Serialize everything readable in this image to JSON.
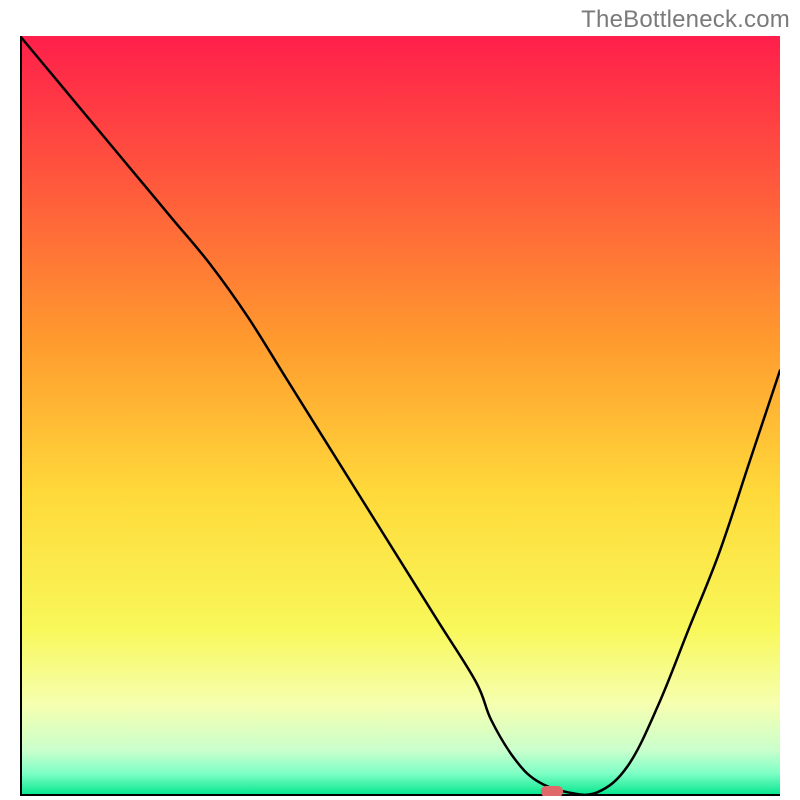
{
  "watermark": "TheBottleneck.com",
  "chart_data": {
    "type": "line",
    "title": "",
    "xlabel": "",
    "ylabel": "",
    "xlim": [
      0,
      100
    ],
    "ylim": [
      0,
      100
    ],
    "grid": false,
    "legend": false,
    "series": [
      {
        "name": "curve",
        "x": [
          0,
          5,
          10,
          15,
          20,
          25,
          30,
          35,
          40,
          45,
          50,
          55,
          60,
          62,
          65,
          68,
          72,
          76,
          80,
          84,
          88,
          92,
          96,
          100
        ],
        "values": [
          100,
          94,
          88,
          82,
          76,
          70,
          63,
          55,
          47,
          39,
          31,
          23,
          15,
          10,
          5,
          2,
          0.5,
          0.5,
          4,
          12,
          22,
          32,
          44,
          56
        ]
      }
    ],
    "marker": {
      "x": 70,
      "y": 0.6,
      "color": "#e06a6a"
    },
    "gradient_background": {
      "stops": [
        {
          "offset": 0.0,
          "color": "#ff1f4b"
        },
        {
          "offset": 0.2,
          "color": "#ff5a3c"
        },
        {
          "offset": 0.4,
          "color": "#ff9a2e"
        },
        {
          "offset": 0.6,
          "color": "#ffd93a"
        },
        {
          "offset": 0.78,
          "color": "#f8f85a"
        },
        {
          "offset": 0.88,
          "color": "#f6ffb0"
        },
        {
          "offset": 0.94,
          "color": "#c9ffcc"
        },
        {
          "offset": 0.97,
          "color": "#7fffc6"
        },
        {
          "offset": 1.0,
          "color": "#00e58b"
        }
      ]
    },
    "axis_color": "#000000"
  }
}
